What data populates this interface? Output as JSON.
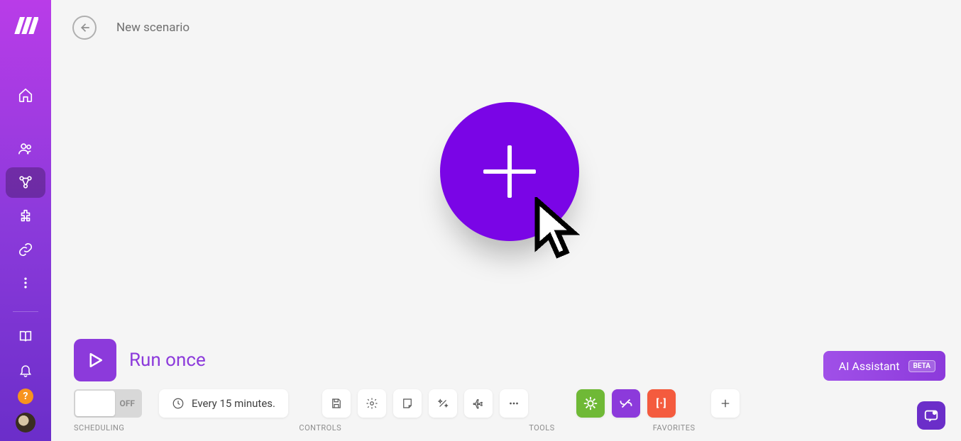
{
  "header": {
    "title": "New scenario"
  },
  "run": {
    "label": "Run once"
  },
  "scheduling": {
    "toggle_state": "OFF",
    "interval_label": "Every 15 minutes.",
    "section_label": "SCHEDULING"
  },
  "controls": {
    "section_label": "CONTROLS",
    "buttons": [
      "save-icon",
      "settings-icon",
      "note-icon",
      "magic-icon",
      "export-icon",
      "more-icon"
    ]
  },
  "tools": {
    "section_label": "TOOLS",
    "items": [
      "flow-control",
      "tools",
      "text-parser"
    ]
  },
  "favorites": {
    "section_label": "FAVORITES"
  },
  "ai": {
    "label": "AI Assistant",
    "beta": "BETA"
  },
  "accent": "#8c3adb",
  "colors": {
    "tool_green": "#6fb936",
    "tool_purple": "#8c3adb",
    "tool_orange": "#f45b3e",
    "help": "#f7931e"
  }
}
